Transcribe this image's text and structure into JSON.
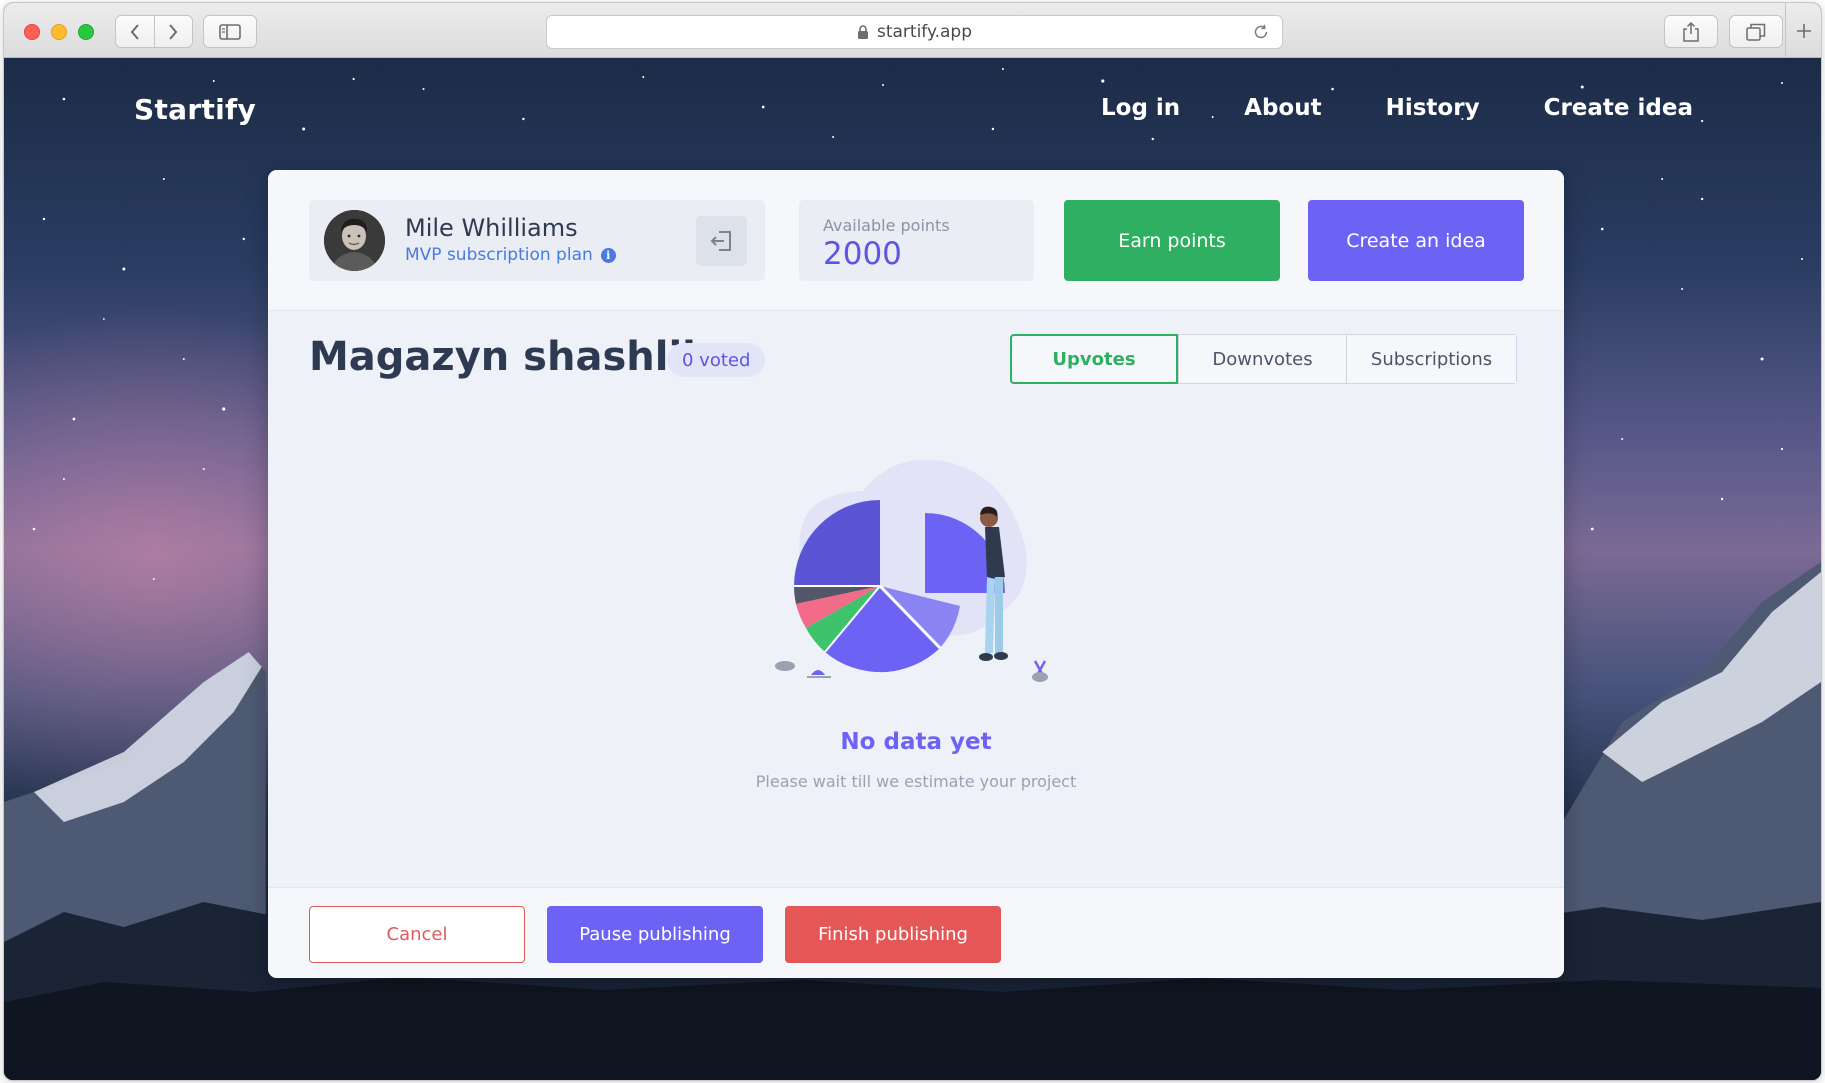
{
  "browser": {
    "url": "startify.app",
    "icons": {
      "back": "chevron-left-icon",
      "forward": "chevron-right-icon",
      "sidebar": "sidebar-icon",
      "lock": "lock-icon",
      "reload": "reload-icon",
      "share": "share-icon",
      "tabs": "tabs-icon",
      "new_tab": "plus-icon"
    }
  },
  "site": {
    "brand": "Startify",
    "nav": {
      "login": "Log in",
      "about": "About",
      "history": "History",
      "create": "Create idea"
    }
  },
  "profile": {
    "name": "Mile Whilliams",
    "plan": "MVP subscription plan",
    "info_icon": "info-icon",
    "logout_icon": "logout-icon"
  },
  "points": {
    "label": "Available points",
    "value": "2000"
  },
  "actions": {
    "earn": "Earn points",
    "create": "Create an idea"
  },
  "idea": {
    "title": "Magazyn shashlika",
    "voted": "0 voted"
  },
  "tabs": {
    "upvotes": "Upvotes",
    "downvotes": "Downvotes",
    "subscriptions": "Subscriptions",
    "active": "Upvotes"
  },
  "empty_state": {
    "title": "No data yet",
    "subtitle": "Please wait till we estimate your project"
  },
  "footer": {
    "cancel": "Cancel",
    "pause": "Pause publishing",
    "finish": "Finish publishing"
  },
  "colors": {
    "accent": "#6c63f5",
    "success": "#2faf62",
    "danger": "#e55757",
    "text_dark": "#2d3a52"
  }
}
